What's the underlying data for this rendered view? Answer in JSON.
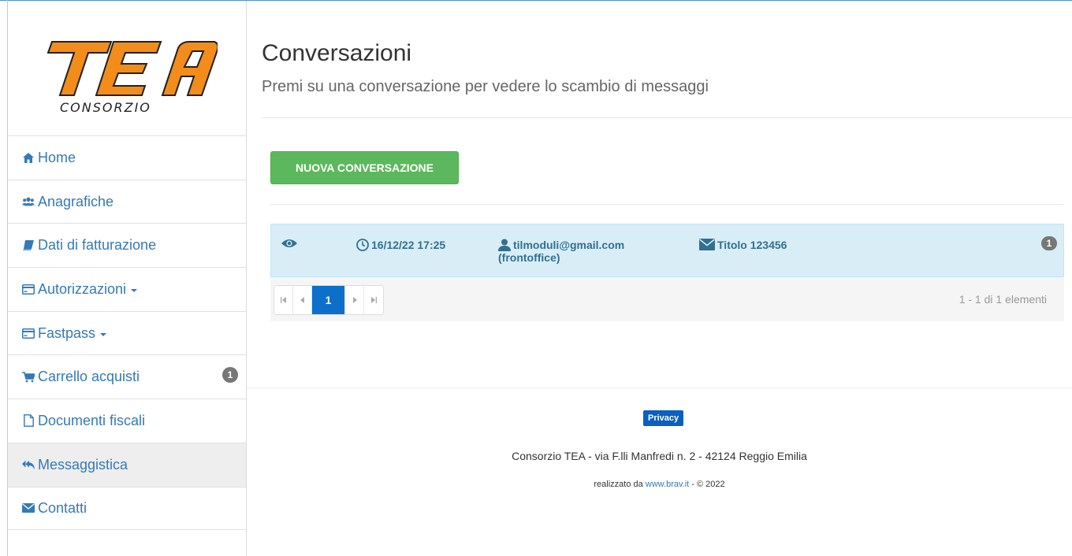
{
  "logo": {
    "brand": "TEA",
    "subtitle": "CONSORZIO",
    "colors": {
      "orange": "#f28c1a",
      "dark": "#222222"
    }
  },
  "sidebar": {
    "items": [
      {
        "label": "Home",
        "icon": "home-icon"
      },
      {
        "label": "Anagrafiche",
        "icon": "users-icon"
      },
      {
        "label": "Dati di fatturazione",
        "icon": "book-icon"
      },
      {
        "label": "Autorizzazioni",
        "icon": "card-icon",
        "dropdown": true
      },
      {
        "label": "Fastpass",
        "icon": "card-icon",
        "dropdown": true
      },
      {
        "label": "Carrello acquisti",
        "icon": "cart-icon",
        "badge": "1"
      },
      {
        "label": "Documenti fiscali",
        "icon": "file-icon"
      },
      {
        "label": "Messaggistica",
        "icon": "reply-all-icon",
        "active": true
      },
      {
        "label": "Contatti",
        "icon": "envelope-icon"
      }
    ]
  },
  "header": {
    "title": "Conversazioni",
    "subtitle": "Premi su una conversazione per vedere lo scambio di messaggi"
  },
  "actions": {
    "new_label": "NUOVA CONVERSAZIONE"
  },
  "conversations": [
    {
      "date": "16/12/22 17:25",
      "user": "tilmoduli@gmail.com",
      "role": "(frontoffice)",
      "subject": "Titolo 123456",
      "unread": "1"
    }
  ],
  "pager": {
    "current": "1",
    "info": "1 - 1 di 1 elementi"
  },
  "footer": {
    "privacy": "Privacy",
    "address": "Consorzio TEA - via F.lli Manfredi n. 2 - 42124 Reggio Emilia",
    "credit_prefix": "realizzato da ",
    "credit_link": "www.brav.it",
    "credit_suffix": " - © 2022"
  },
  "colors": {
    "link": "#337ab7",
    "success": "#5cb85c",
    "row_bg": "#d9edf7",
    "pager_active": "#0c6fc9"
  }
}
